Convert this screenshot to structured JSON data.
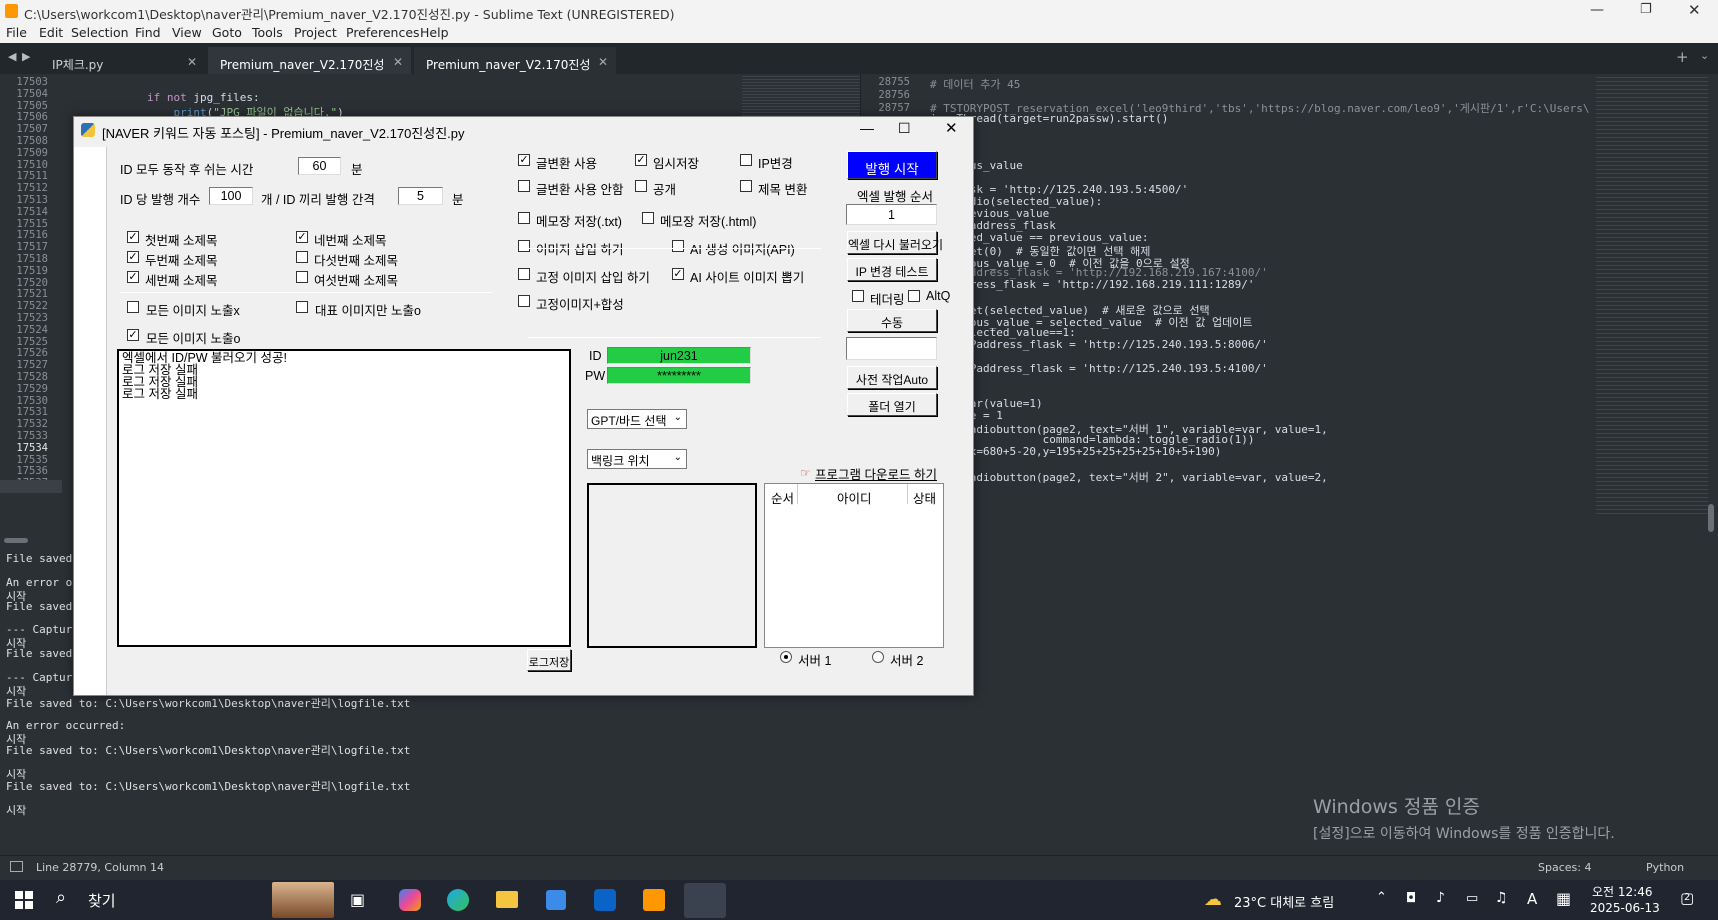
{
  "window": {
    "title": "C:\\Users\\workcom1\\Desktop\\naver관리\\Premium_naver_V2.170진성진.py - Sublime Text (UNREGISTERED)",
    "controls": [
      "—",
      "❐",
      "✕"
    ]
  },
  "menu": [
    "File",
    "Edit",
    "Selection",
    "Find",
    "View",
    "Goto",
    "Tools",
    "Project",
    "Preferences",
    "Help"
  ],
  "tabs": [
    {
      "label": "IP체크.py",
      "active": false
    },
    {
      "label": "Premium_naver_V2.170진성진.py",
      "active": false
    },
    {
      "label": "Premium_naver_V2.170진성진.py",
      "active": true
    }
  ],
  "left_editor": {
    "line_numbers": [
      "17503",
      "17504",
      "17505",
      "17506",
      "17507",
      "17508",
      "17509",
      "17510",
      "17511",
      "17512",
      "17513",
      "17514",
      "17515",
      "17516",
      "17517",
      "17518",
      "17519",
      "17520",
      "17521",
      "17522",
      "17523",
      "17524",
      "17525",
      "17526",
      "17527",
      "17528",
      "17529",
      "17530",
      "17531",
      "17532",
      "17533",
      "17534",
      "17535",
      "17536",
      "17537"
    ],
    "current_line": "17534",
    "code": [
      {
        "text": "if not jpg_files:"
      },
      {
        "text": "    print(\"JPG 파일이 없습니다.\")"
      }
    ]
  },
  "right_editor": {
    "line_numbers": [
      "28755",
      "28756",
      "28757"
    ],
    "code": [
      "# 데이터 추가 45",
      "",
      "# TSTORYPOST_reservation_excel('leo9third','tbs','https://blog.naver.com/leo9','게시판/1',r'C:\\Users\\leo9\\Docu",
      "ing.Thread(target=run2passw).start()",
      "",
      "",
      "",
      "previous_value",
      "",
      "ss_flask = 'http://125.240.193.5:4500/'",
      "gle_radio(selected_value):",
      "bal previous_value",
      "bal IPaddress_flask",
      "selected_value == previous_value:",
      " var.set(0)  # 동일한 값이면 선택 해제",
      " previous_value = 0  # 이전 값을 0으로 설정",
      " # IPaddress_flask = 'http://192.168.219.167:4100/'",
      " IPaddress_flask = 'http://192.168.219.111:1289/'",
      "e:",
      " var.set(selected_value)  # 새로운 값으로 선택",
      " previous_value = selected_value  # 이전 값 업데이트",
      " if selected_value==1:",
      "     IPaddress_flask = 'http://125.240.193.5:8006/'",
      " else:",
      "     IPaddress_flask = 'http://125.240.193.5:4100/'",
      "",
      "",
      "k.IntVar(value=1)",
      "s_value = 1",
      "= tk.Radiobutton(page2, text=\"서버 1\", variable=var, value=1,",
      "                 command=lambda: toggle_radio(1))",
      "place(x=680+5-20,y=195+25+25+25+25+10+5+190)",
      "",
      "= tk.Radiobutton(page2, text=\"서버 2\", variable=var, value=2,"
    ]
  },
  "console_lines": [
    "File saved",
    "",
    "An error occ",
    "시작",
    "File saved",
    "",
    "--- Capture",
    "시작",
    "File saved",
    "",
    "--- Capture",
    "시작",
    "File saved to: C:\\Users\\workcom1\\Desktop\\naver관리\\logfile.txt",
    "",
    "An error occurred:",
    "시작",
    "File saved to: C:\\Users\\workcom1\\Desktop\\naver관리\\logfile.txt",
    "",
    "시작",
    "File saved to: C:\\Users\\workcom1\\Desktop\\naver관리\\logfile.txt",
    "",
    "시작"
  ],
  "watermark": {
    "line1": "Windows 정품 인증",
    "line2": "[설정]으로 이동하여 Windows를 정품 인증합니다."
  },
  "status": {
    "position": "Line 28779, Column 14",
    "spaces": "Spaces: 4",
    "syntax": "Python"
  },
  "dialog": {
    "title": "[NAVER 키워드 자동 포스팅] - Premium_naver_V2.170진성진.py",
    "rest_label": "ID 모두 동작 후 쉬는 시간",
    "rest_value": "60",
    "rest_unit": "분",
    "count_label": "ID 당 발행 개수",
    "count_value": "100",
    "count_mid": "개 / ID 끼리 발행 간격",
    "interval_value": "5",
    "interval_unit": "분",
    "subtitles": [
      {
        "label": "첫번째 소제목",
        "checked": true
      },
      {
        "label": "두번째 소제목",
        "checked": true
      },
      {
        "label": "세번째 소제목",
        "checked": true
      },
      {
        "label": "네번째 소제목",
        "checked": true
      },
      {
        "label": "다섯번째 소제목",
        "checked": false
      },
      {
        "label": "여섯번째 소제목",
        "checked": false
      }
    ],
    "img_all_x": {
      "label": "모든 이미지 노출x",
      "checked": false
    },
    "img_rep_o": {
      "label": "대표 이미지만 노출o",
      "checked": false
    },
    "img_all_o": {
      "label": "모든 이미지 노출o",
      "checked": true
    },
    "log_lines": [
      "엑셀에서 ID/PW 불러오기 성공!",
      "로그 저장 실패",
      "로그 저장 실패",
      "로그 저장 실패"
    ],
    "log_save": "로그저장",
    "options": [
      {
        "label": "글변환 사용",
        "checked": true
      },
      {
        "label": "임시저장",
        "checked": true
      },
      {
        "label": "IP변경",
        "checked": false
      },
      {
        "label": "글변환 사용 안함",
        "checked": false
      },
      {
        "label": "공개",
        "checked": false
      },
      {
        "label": "제목 변환",
        "checked": false
      },
      {
        "label": "메모장 저장(.txt)",
        "checked": false
      },
      {
        "label": "메모장 저장(.html)",
        "checked": false
      },
      {
        "label": "이미지 삽입 하기",
        "checked": false
      },
      {
        "label": "AI 생성 이미지(API)",
        "checked": false
      },
      {
        "label": "고정 이미지 삽입 하기",
        "checked": false
      },
      {
        "label": "AI 사이트 이미지 뽑기",
        "checked": true
      },
      {
        "label": "고정이미지+합성",
        "checked": false
      }
    ],
    "id_label": "ID",
    "id_value": "jun231",
    "pw_label": "PW",
    "pw_value": "*********",
    "gpt_select": "GPT/바드 선택",
    "backlink_select": "백링크 위치",
    "download_link": "프로그램 다운로드 하기",
    "table_headers": [
      "순서",
      "아이디",
      "상태"
    ],
    "server1": "서버 1",
    "server2": "서버 2",
    "server_selected": "서버 1",
    "publish_start": "발행 시작",
    "excel_order_label": "엑셀 발행 순서",
    "excel_order_value": "1",
    "excel_reload": "엑셀 다시 불러오기",
    "ip_test": "IP 변경 테스트",
    "tethering": {
      "label": "테더링",
      "checked": false
    },
    "altq": {
      "label": "AltQ",
      "checked": false
    },
    "manual": "수동",
    "pre_work": "사전 작업Auto",
    "open_folder": "폴더 열기",
    "accent_color": "#0000ff",
    "field_green": "#22cc44"
  },
  "taskbar": {
    "search": "찾기",
    "weather": "23°C 대체로 흐림",
    "time": "오전 12:46",
    "date": "2025-06-13",
    "ime": "A",
    "notif_count": "2"
  }
}
